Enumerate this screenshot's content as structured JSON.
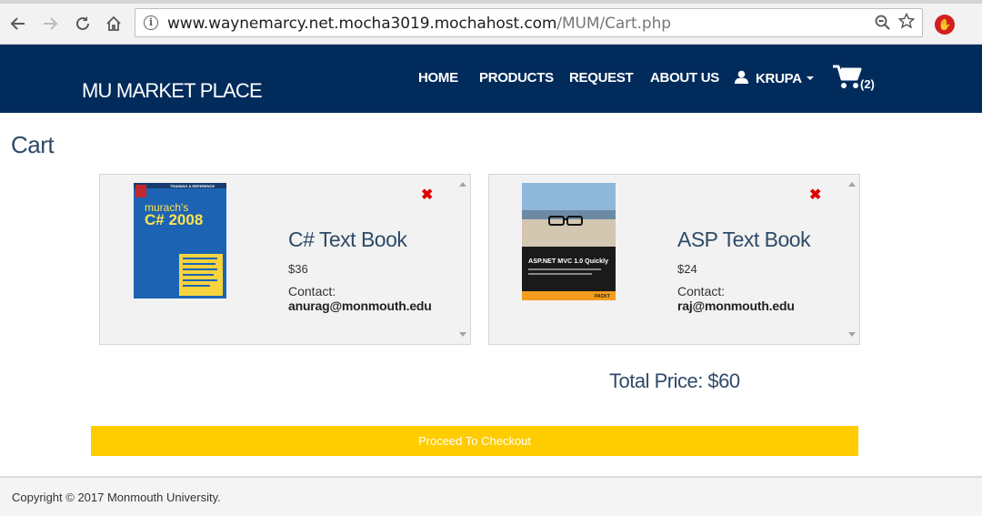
{
  "browser": {
    "url_domain": "www.waynemarcy.net.mocha3019.mochahost.com",
    "url_path": "/MUM/Cart.php",
    "back_icon": "arrow-left-icon",
    "forward_icon": "arrow-right-icon",
    "reload_icon": "reload-icon",
    "home_icon": "home-icon"
  },
  "header": {
    "brand": "MU MARKET PLACE",
    "nav": {
      "home": "HOME",
      "products": "PRODUCTS",
      "request": "REQUEST",
      "about": "ABOUT US",
      "user": "KRUPA"
    },
    "cart_count": "(2)",
    "background_color": "#012b5b"
  },
  "page": {
    "title": "Cart"
  },
  "cart": {
    "items": [
      {
        "title": "C# Text Book",
        "price": "$36",
        "contact_label": "Contact:",
        "contact": "anurag@monmouth.edu",
        "cover": {
          "series": "TRAINING & REFERENCE",
          "brand": "murach's",
          "name": "C# 2008"
        }
      },
      {
        "title": "ASP Text Book",
        "price": "$24",
        "contact_label": "Contact:",
        "contact": "raj@monmouth.edu",
        "cover": {
          "name": "ASP.NET MVC 1.0 Quickly",
          "publisher": "PACKT"
        }
      }
    ],
    "remove_icon": "close-icon",
    "total": "Total Price: $60",
    "checkout_label": "Proceed To Checkout",
    "checkout_color": "#ffcc00"
  },
  "footer": {
    "copyright": "Copyright © 2017 Monmouth University."
  }
}
